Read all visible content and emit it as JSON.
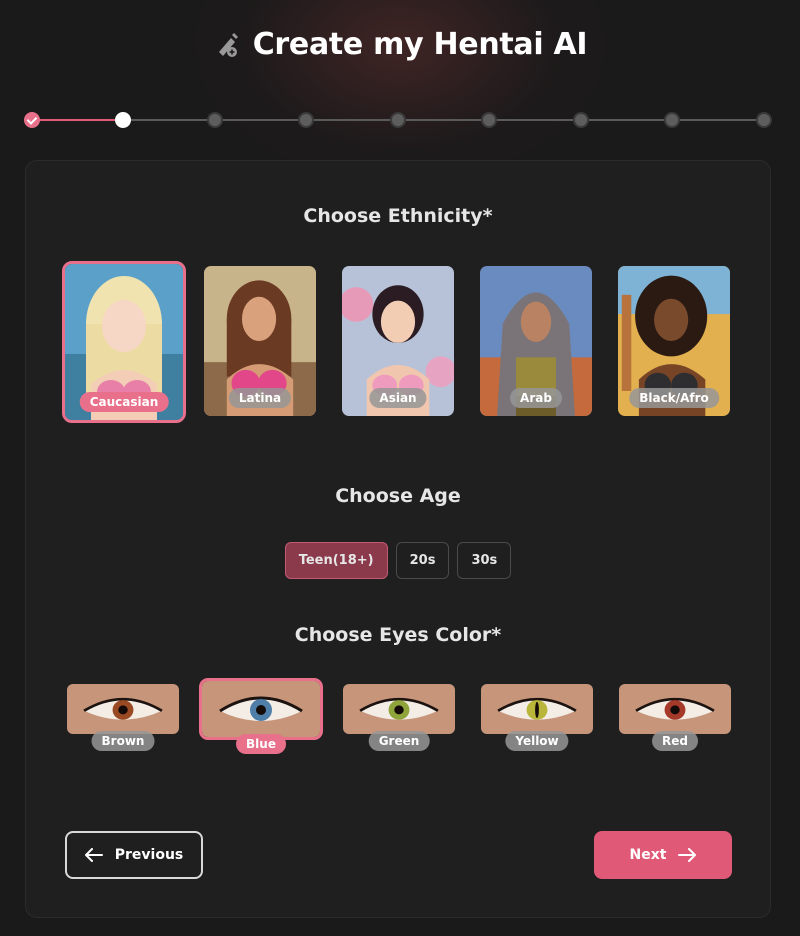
{
  "header": {
    "title": "Create my Hentai AI",
    "icon": "wand-icon"
  },
  "stepper": {
    "total_steps": 9,
    "current_step": 2,
    "completed_steps": 1
  },
  "ethnicity": {
    "title": "Choose Ethnicity*",
    "options": [
      {
        "label": "Caucasian",
        "selected": true
      },
      {
        "label": "Latina",
        "selected": false
      },
      {
        "label": "Asian",
        "selected": false
      },
      {
        "label": "Arab",
        "selected": false
      },
      {
        "label": "Black/Afro",
        "selected": false
      }
    ]
  },
  "age": {
    "title": "Choose Age",
    "options": [
      {
        "label": "Teen(18+)",
        "selected": true
      },
      {
        "label": "20s",
        "selected": false
      },
      {
        "label": "30s",
        "selected": false
      }
    ]
  },
  "eyes": {
    "title": "Choose Eyes Color*",
    "options": [
      {
        "label": "Brown",
        "selected": false,
        "iris": "#9a4a22"
      },
      {
        "label": "Blue",
        "selected": true,
        "iris": "#4f7fa8"
      },
      {
        "label": "Green",
        "selected": false,
        "iris": "#8fa43a"
      },
      {
        "label": "Yellow",
        "selected": false,
        "iris": "#b9b43a"
      },
      {
        "label": "Red",
        "selected": false,
        "iris": "#a63a2a"
      }
    ]
  },
  "navigation": {
    "previous_label": "Previous",
    "next_label": "Next"
  },
  "colors": {
    "accent": "#e05a78",
    "background": "#1a1a1b",
    "card": "#1f1f20",
    "age_selected": "#8a3a4b"
  }
}
